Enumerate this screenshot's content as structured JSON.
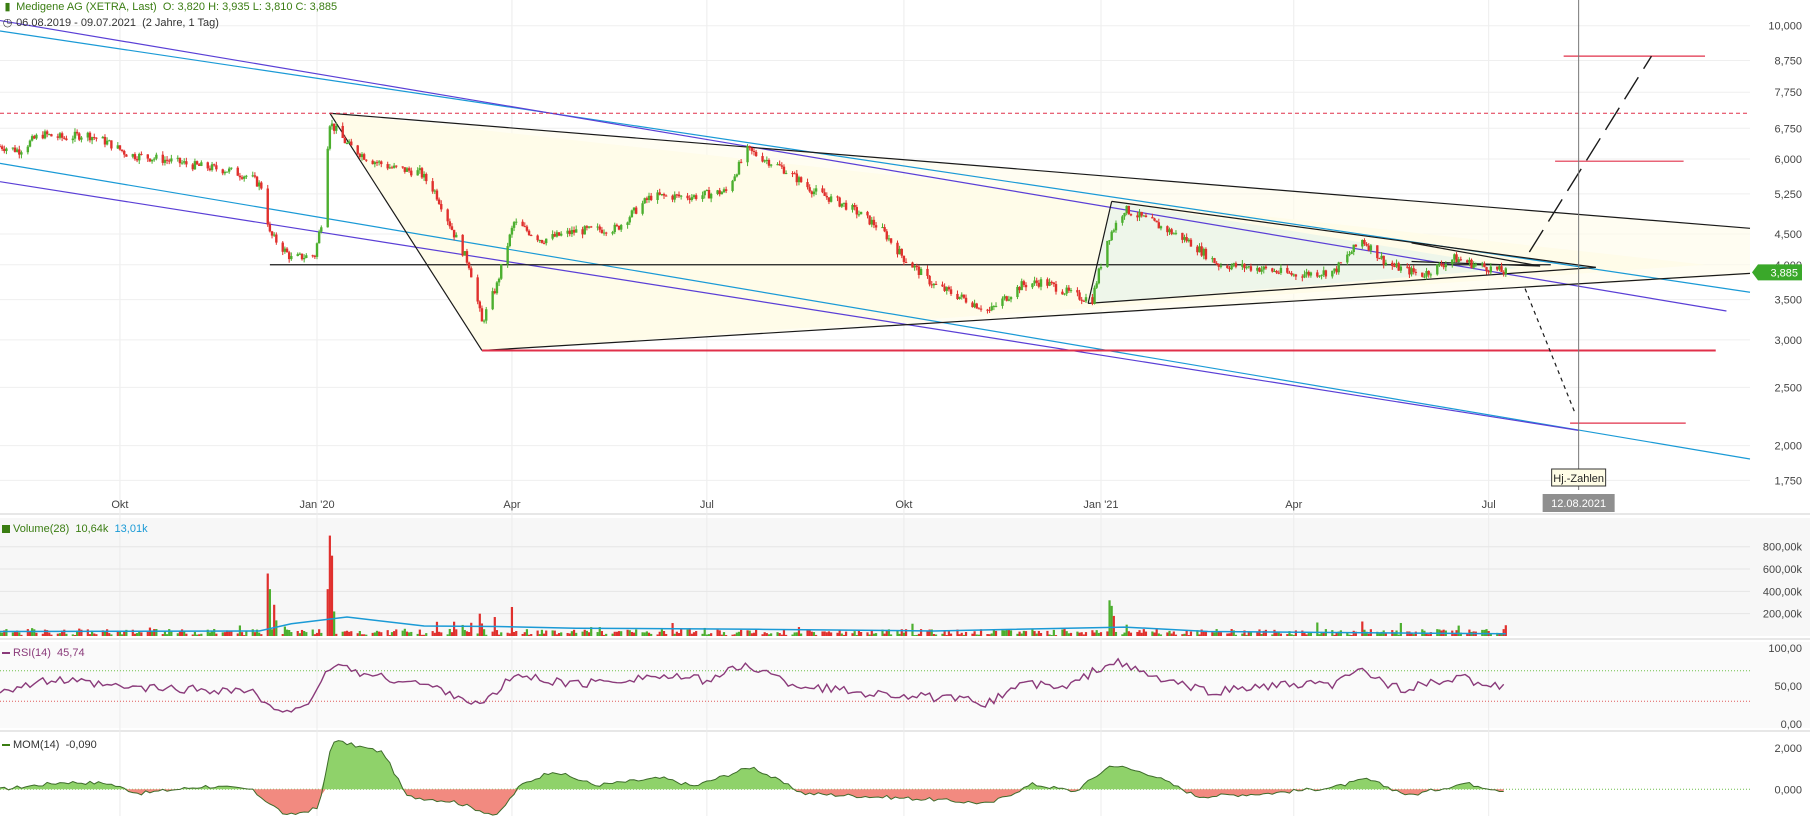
{
  "header": {
    "instrument": "Medigene AG (XETRA, Last)",
    "ohlc": "O: 3,820  H: 3,935  L: 3,810  C: 3,885",
    "range": "06.08.2019 - 09.07.2021",
    "range_detail": "(2 Jahre, 1 Tag)",
    "instrument_icon": "bar-chart-icon",
    "range_icon": "clock-icon"
  },
  "colors": {
    "up": "#4caf2f",
    "down": "#e0302d",
    "channel_blue": "#1a9ad6",
    "channel_purple": "#5a3fd6",
    "target_red": "#e0304a",
    "rsi": "#8a3a7a",
    "volume_avg": "#1a9ad6",
    "price_badge": "#3aa82a"
  },
  "chart_data": [
    {
      "type": "line",
      "name": "price",
      "x_ticks": [
        "Okt",
        "Jan '20",
        "Apr",
        "Jul",
        "Okt",
        "Jan '21",
        "Apr",
        "Jul"
      ],
      "x_tick_dates": [
        "2019-10-01",
        "2020-01-01",
        "2020-04-01",
        "2020-07-01",
        "2020-10-01",
        "2021-01-01",
        "2021-04-01",
        "2021-07-01"
      ],
      "x_range": [
        "2019-08-06",
        "2021-10-31"
      ],
      "y_scale": "log",
      "y_ticks": [
        "10,000",
        "8,750",
        "7,750",
        "6,750",
        "6,000",
        "5,250",
        "4,500",
        "4,000",
        "3,500",
        "3,000",
        "2,500",
        "2,000",
        "1,750"
      ],
      "y_tick_values": [
        10.0,
        8.75,
        7.75,
        6.75,
        6.0,
        5.25,
        4.5,
        4.0,
        3.5,
        3.0,
        2.5,
        2.0,
        1.75
      ],
      "ylim": [
        1.7,
        10.3
      ],
      "last_price": "3,885",
      "closes": [
        [
          "2019-08-06",
          6.3
        ],
        [
          "2019-08-15",
          6.2
        ],
        [
          "2019-08-25",
          6.6
        ],
        [
          "2019-09-05",
          6.5
        ],
        [
          "2019-09-15",
          6.6
        ],
        [
          "2019-09-25",
          6.4
        ],
        [
          "2019-10-05",
          6.1
        ],
        [
          "2019-10-20",
          6.0
        ],
        [
          "2019-11-05",
          5.85
        ],
        [
          "2019-11-20",
          5.75
        ],
        [
          "2019-12-01",
          5.6
        ],
        [
          "2019-12-06",
          5.4
        ],
        [
          "2019-12-10",
          4.5
        ],
        [
          "2019-12-20",
          4.1
        ],
        [
          "2019-12-31",
          4.15
        ],
        [
          "2020-01-03",
          4.7
        ],
        [
          "2020-01-07",
          6.9
        ],
        [
          "2020-01-15",
          6.35
        ],
        [
          "2020-01-25",
          6.0
        ],
        [
          "2020-02-05",
          5.8
        ],
        [
          "2020-02-18",
          5.7
        ],
        [
          "2020-02-25",
          5.3
        ],
        [
          "2020-03-05",
          4.5
        ],
        [
          "2020-03-12",
          4.0
        ],
        [
          "2020-03-18",
          3.2
        ],
        [
          "2020-03-25",
          3.7
        ],
        [
          "2020-04-02",
          4.7
        ],
        [
          "2020-04-15",
          4.4
        ],
        [
          "2020-05-01",
          4.55
        ],
        [
          "2020-05-20",
          4.6
        ],
        [
          "2020-06-05",
          5.2
        ],
        [
          "2020-06-25",
          5.2
        ],
        [
          "2020-07-10",
          5.3
        ],
        [
          "2020-07-20",
          6.2
        ],
        [
          "2020-08-05",
          5.8
        ],
        [
          "2020-08-20",
          5.3
        ],
        [
          "2020-09-05",
          5.0
        ],
        [
          "2020-09-20",
          4.6
        ],
        [
          "2020-10-01",
          4.1
        ],
        [
          "2020-10-15",
          3.7
        ],
        [
          "2020-10-30",
          3.5
        ],
        [
          "2020-11-10",
          3.35
        ],
        [
          "2020-11-25",
          3.7
        ],
        [
          "2020-12-05",
          3.75
        ],
        [
          "2020-12-20",
          3.55
        ],
        [
          "2020-12-28",
          3.5
        ],
        [
          "2021-01-04",
          4.4
        ],
        [
          "2021-01-12",
          4.95
        ],
        [
          "2021-01-25",
          4.7
        ],
        [
          "2021-02-10",
          4.4
        ],
        [
          "2021-02-25",
          4.0
        ],
        [
          "2021-03-15",
          3.95
        ],
        [
          "2021-04-01",
          3.85
        ],
        [
          "2021-04-20",
          3.9
        ],
        [
          "2021-05-03",
          4.4
        ],
        [
          "2021-05-15",
          4.0
        ],
        [
          "2021-05-31",
          3.85
        ],
        [
          "2021-06-15",
          4.1
        ],
        [
          "2021-06-25",
          4.0
        ],
        [
          "2021-07-09",
          3.885
        ]
      ],
      "annotations": {
        "event_label": "Hj.-Zahlen",
        "event_date_label": "12.08.2021",
        "event_date": "2021-08-12",
        "resistance_dashed": 7.15,
        "support_line": 4.0,
        "lower_target": 2.88,
        "target_upper_1": 8.9,
        "target_upper_2": 5.95,
        "target_lower": 2.18
      }
    },
    {
      "type": "bar",
      "name": "Volume(28)",
      "legend": "Volume(28)",
      "legend_values": [
        "10,64k",
        "13,01k"
      ],
      "y_ticks": [
        "800,00k",
        "600,00k",
        "400,00k",
        "200,00k"
      ],
      "y_tick_values": [
        800000,
        600000,
        400000,
        200000
      ],
      "ylim": [
        0,
        950000
      ],
      "spikes": [
        [
          "2019-12-09",
          560000
        ],
        [
          "2019-12-10",
          420000
        ],
        [
          "2019-12-12",
          280000
        ],
        [
          "2019-12-13",
          140000
        ],
        [
          "2020-01-06",
          420000
        ],
        [
          "2020-01-07",
          900000
        ],
        [
          "2020-01-08",
          720000
        ],
        [
          "2020-01-09",
          220000
        ],
        [
          "2020-03-17",
          200000
        ],
        [
          "2020-03-24",
          170000
        ],
        [
          "2020-04-01",
          260000
        ],
        [
          "2021-01-05",
          320000
        ],
        [
          "2021-01-06",
          270000
        ],
        [
          "2021-01-07",
          180000
        ],
        [
          "2020-10-05",
          110000
        ],
        [
          "2021-05-03",
          130000
        ]
      ]
    },
    {
      "type": "line",
      "name": "RSI(14)",
      "legend": "RSI(14)",
      "legend_value": "45,74",
      "y_ticks": [
        "100,00",
        "50,00",
        "0,00"
      ],
      "y_tick_values": [
        100,
        50,
        0
      ],
      "ylim": [
        -5,
        105
      ],
      "overbought": 70,
      "oversold": 30,
      "points": [
        [
          "2019-08-06",
          45
        ],
        [
          "2019-09-01",
          58
        ],
        [
          "2019-10-01",
          48
        ],
        [
          "2019-11-01",
          46
        ],
        [
          "2019-12-01",
          44
        ],
        [
          "2019-12-12",
          15
        ],
        [
          "2019-12-30",
          30
        ],
        [
          "2020-01-08",
          80
        ],
        [
          "2020-01-25",
          64
        ],
        [
          "2020-02-15",
          55
        ],
        [
          "2020-03-01",
          44
        ],
        [
          "2020-03-18",
          24
        ],
        [
          "2020-04-02",
          64
        ],
        [
          "2020-05-01",
          52
        ],
        [
          "2020-06-05",
          63
        ],
        [
          "2020-07-01",
          58
        ],
        [
          "2020-07-20",
          78
        ],
        [
          "2020-08-10",
          52
        ],
        [
          "2020-09-10",
          42
        ],
        [
          "2020-10-05",
          37
        ],
        [
          "2020-11-10",
          28
        ],
        [
          "2020-11-25",
          55
        ],
        [
          "2020-12-15",
          46
        ],
        [
          "2021-01-06",
          83
        ],
        [
          "2021-01-25",
          62
        ],
        [
          "2021-02-20",
          42
        ],
        [
          "2021-03-20",
          50
        ],
        [
          "2021-04-20",
          52
        ],
        [
          "2021-05-03",
          71
        ],
        [
          "2021-05-20",
          46
        ],
        [
          "2021-06-20",
          60
        ],
        [
          "2021-07-09",
          45.74
        ]
      ]
    },
    {
      "type": "area",
      "name": "MOM(14)",
      "legend": "MOM(14)",
      "legend_value": "-0,090",
      "y_ticks": [
        "2,000",
        "0,000"
      ],
      "y_tick_values": [
        2,
        0
      ],
      "ylim": [
        -1.3,
        2.4
      ],
      "points": [
        [
          "2019-08-06",
          0.0
        ],
        [
          "2019-09-05",
          0.35
        ],
        [
          "2019-09-25",
          0.3
        ],
        [
          "2019-10-10",
          -0.2
        ],
        [
          "2019-11-10",
          0.15
        ],
        [
          "2019-12-01",
          0.0
        ],
        [
          "2019-12-18",
          -1.3
        ],
        [
          "2020-01-02",
          -0.9
        ],
        [
          "2020-01-08",
          2.4
        ],
        [
          "2020-02-01",
          1.8
        ],
        [
          "2020-02-12",
          -0.35
        ],
        [
          "2020-03-05",
          -0.6
        ],
        [
          "2020-03-25",
          -1.3
        ],
        [
          "2020-04-05",
          0.2
        ],
        [
          "2020-04-20",
          0.9
        ],
        [
          "2020-05-10",
          0.2
        ],
        [
          "2020-06-10",
          0.55
        ],
        [
          "2020-06-25",
          0.15
        ],
        [
          "2020-07-22",
          1.1
        ],
        [
          "2020-08-15",
          -0.2
        ],
        [
          "2020-09-15",
          -0.35
        ],
        [
          "2020-10-15",
          -0.5
        ],
        [
          "2020-11-10",
          -0.7
        ],
        [
          "2020-11-30",
          0.25
        ],
        [
          "2020-12-20",
          -0.1
        ],
        [
          "2021-01-06",
          1.2
        ],
        [
          "2021-01-25",
          0.7
        ],
        [
          "2021-02-15",
          -0.35
        ],
        [
          "2021-03-20",
          -0.2
        ],
        [
          "2021-04-20",
          0.1
        ],
        [
          "2021-05-05",
          0.5
        ],
        [
          "2021-05-25",
          -0.3
        ],
        [
          "2021-06-20",
          0.3
        ],
        [
          "2021-07-09",
          -0.09
        ]
      ]
    }
  ]
}
